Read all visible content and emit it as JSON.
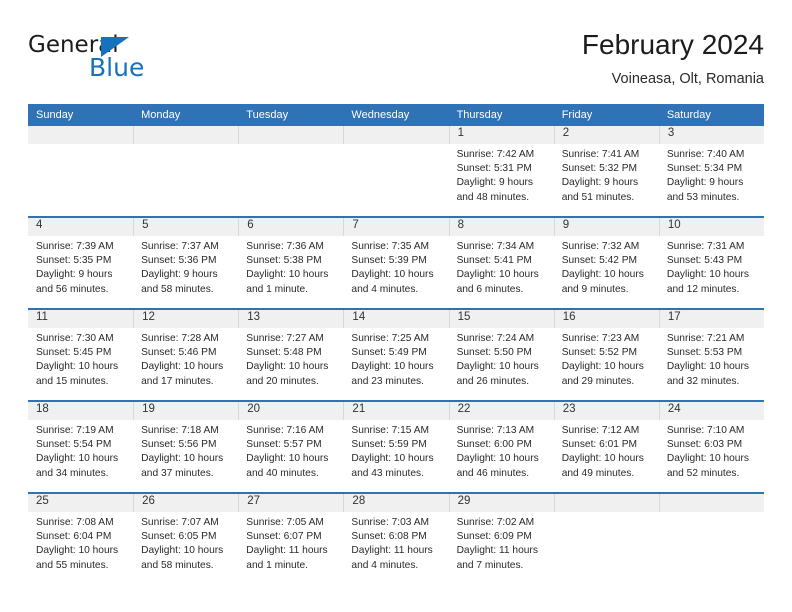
{
  "logo": {
    "primary_text": "General",
    "secondary_text": "Blue",
    "triangle_icon": "triangle-icon",
    "brand_color": "#1672BC"
  },
  "header": {
    "title": "February 2024",
    "subtitle": "Voineasa, Olt, Romania",
    "header_bg_color": "#2F72B5",
    "daynum_band_color": "#F0F0F0"
  },
  "weekdays": [
    "Sunday",
    "Monday",
    "Tuesday",
    "Wednesday",
    "Thursday",
    "Friday",
    "Saturday"
  ],
  "weeks": [
    [
      {
        "day": "",
        "empty": true
      },
      {
        "day": "",
        "empty": true
      },
      {
        "day": "",
        "empty": true
      },
      {
        "day": "",
        "empty": true
      },
      {
        "day": "1",
        "sunrise": "Sunrise: 7:42 AM",
        "sunset": "Sunset: 5:31 PM",
        "daylight": "Daylight: 9 hours and 48 minutes."
      },
      {
        "day": "2",
        "sunrise": "Sunrise: 7:41 AM",
        "sunset": "Sunset: 5:32 PM",
        "daylight": "Daylight: 9 hours and 51 minutes."
      },
      {
        "day": "3",
        "sunrise": "Sunrise: 7:40 AM",
        "sunset": "Sunset: 5:34 PM",
        "daylight": "Daylight: 9 hours and 53 minutes."
      }
    ],
    [
      {
        "day": "4",
        "sunrise": "Sunrise: 7:39 AM",
        "sunset": "Sunset: 5:35 PM",
        "daylight": "Daylight: 9 hours and 56 minutes."
      },
      {
        "day": "5",
        "sunrise": "Sunrise: 7:37 AM",
        "sunset": "Sunset: 5:36 PM",
        "daylight": "Daylight: 9 hours and 58 minutes."
      },
      {
        "day": "6",
        "sunrise": "Sunrise: 7:36 AM",
        "sunset": "Sunset: 5:38 PM",
        "daylight": "Daylight: 10 hours and 1 minute."
      },
      {
        "day": "7",
        "sunrise": "Sunrise: 7:35 AM",
        "sunset": "Sunset: 5:39 PM",
        "daylight": "Daylight: 10 hours and 4 minutes."
      },
      {
        "day": "8",
        "sunrise": "Sunrise: 7:34 AM",
        "sunset": "Sunset: 5:41 PM",
        "daylight": "Daylight: 10 hours and 6 minutes."
      },
      {
        "day": "9",
        "sunrise": "Sunrise: 7:32 AM",
        "sunset": "Sunset: 5:42 PM",
        "daylight": "Daylight: 10 hours and 9 minutes."
      },
      {
        "day": "10",
        "sunrise": "Sunrise: 7:31 AM",
        "sunset": "Sunset: 5:43 PM",
        "daylight": "Daylight: 10 hours and 12 minutes."
      }
    ],
    [
      {
        "day": "11",
        "sunrise": "Sunrise: 7:30 AM",
        "sunset": "Sunset: 5:45 PM",
        "daylight": "Daylight: 10 hours and 15 minutes."
      },
      {
        "day": "12",
        "sunrise": "Sunrise: 7:28 AM",
        "sunset": "Sunset: 5:46 PM",
        "daylight": "Daylight: 10 hours and 17 minutes."
      },
      {
        "day": "13",
        "sunrise": "Sunrise: 7:27 AM",
        "sunset": "Sunset: 5:48 PM",
        "daylight": "Daylight: 10 hours and 20 minutes."
      },
      {
        "day": "14",
        "sunrise": "Sunrise: 7:25 AM",
        "sunset": "Sunset: 5:49 PM",
        "daylight": "Daylight: 10 hours and 23 minutes."
      },
      {
        "day": "15",
        "sunrise": "Sunrise: 7:24 AM",
        "sunset": "Sunset: 5:50 PM",
        "daylight": "Daylight: 10 hours and 26 minutes."
      },
      {
        "day": "16",
        "sunrise": "Sunrise: 7:23 AM",
        "sunset": "Sunset: 5:52 PM",
        "daylight": "Daylight: 10 hours and 29 minutes."
      },
      {
        "day": "17",
        "sunrise": "Sunrise: 7:21 AM",
        "sunset": "Sunset: 5:53 PM",
        "daylight": "Daylight: 10 hours and 32 minutes."
      }
    ],
    [
      {
        "day": "18",
        "sunrise": "Sunrise: 7:19 AM",
        "sunset": "Sunset: 5:54 PM",
        "daylight": "Daylight: 10 hours and 34 minutes."
      },
      {
        "day": "19",
        "sunrise": "Sunrise: 7:18 AM",
        "sunset": "Sunset: 5:56 PM",
        "daylight": "Daylight: 10 hours and 37 minutes."
      },
      {
        "day": "20",
        "sunrise": "Sunrise: 7:16 AM",
        "sunset": "Sunset: 5:57 PM",
        "daylight": "Daylight: 10 hours and 40 minutes."
      },
      {
        "day": "21",
        "sunrise": "Sunrise: 7:15 AM",
        "sunset": "Sunset: 5:59 PM",
        "daylight": "Daylight: 10 hours and 43 minutes."
      },
      {
        "day": "22",
        "sunrise": "Sunrise: 7:13 AM",
        "sunset": "Sunset: 6:00 PM",
        "daylight": "Daylight: 10 hours and 46 minutes."
      },
      {
        "day": "23",
        "sunrise": "Sunrise: 7:12 AM",
        "sunset": "Sunset: 6:01 PM",
        "daylight": "Daylight: 10 hours and 49 minutes."
      },
      {
        "day": "24",
        "sunrise": "Sunrise: 7:10 AM",
        "sunset": "Sunset: 6:03 PM",
        "daylight": "Daylight: 10 hours and 52 minutes."
      }
    ],
    [
      {
        "day": "25",
        "sunrise": "Sunrise: 7:08 AM",
        "sunset": "Sunset: 6:04 PM",
        "daylight": "Daylight: 10 hours and 55 minutes."
      },
      {
        "day": "26",
        "sunrise": "Sunrise: 7:07 AM",
        "sunset": "Sunset: 6:05 PM",
        "daylight": "Daylight: 10 hours and 58 minutes."
      },
      {
        "day": "27",
        "sunrise": "Sunrise: 7:05 AM",
        "sunset": "Sunset: 6:07 PM",
        "daylight": "Daylight: 11 hours and 1 minute."
      },
      {
        "day": "28",
        "sunrise": "Sunrise: 7:03 AM",
        "sunset": "Sunset: 6:08 PM",
        "daylight": "Daylight: 11 hours and 4 minutes."
      },
      {
        "day": "29",
        "sunrise": "Sunrise: 7:02 AM",
        "sunset": "Sunset: 6:09 PM",
        "daylight": "Daylight: 11 hours and 7 minutes."
      },
      {
        "day": "",
        "empty": true
      },
      {
        "day": "",
        "empty": true
      }
    ]
  ]
}
